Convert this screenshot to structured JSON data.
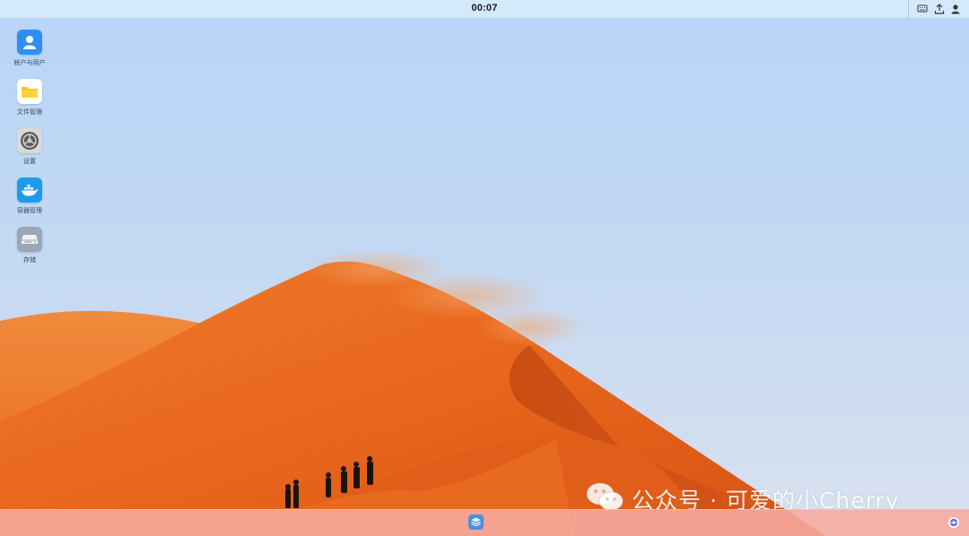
{
  "topbar": {
    "clock": "00:07",
    "tray": [
      {
        "name": "keyboard-icon"
      },
      {
        "name": "upload-icon"
      },
      {
        "name": "user-icon"
      }
    ]
  },
  "desktop_icons": [
    {
      "label": "帐户与用户",
      "icon": "user-account-icon",
      "color": "#2f8ef6"
    },
    {
      "label": "文件管理",
      "icon": "folder-icon",
      "color": "#ffffff"
    },
    {
      "label": "设置",
      "icon": "settings-gear-icon",
      "color": "#6b6b6b"
    },
    {
      "label": "容器管理",
      "icon": "docker-whale-icon",
      "color": "#1d9bf0"
    },
    {
      "label": "存储",
      "icon": "storage-drive-icon",
      "color": "#9aa7b4"
    }
  ],
  "watermark": {
    "text": "公众号 · 可爱的小Cherry",
    "icon": "wechat-icon"
  },
  "dock": {
    "launcher_icon": "app-launcher-icon",
    "corner_icon": "browser-globe-icon"
  },
  "colors": {
    "topbar": "#d6ecfa",
    "dock": "#f6aaa0",
    "sky": "#bcd5f3",
    "dune": "#e8651c"
  }
}
